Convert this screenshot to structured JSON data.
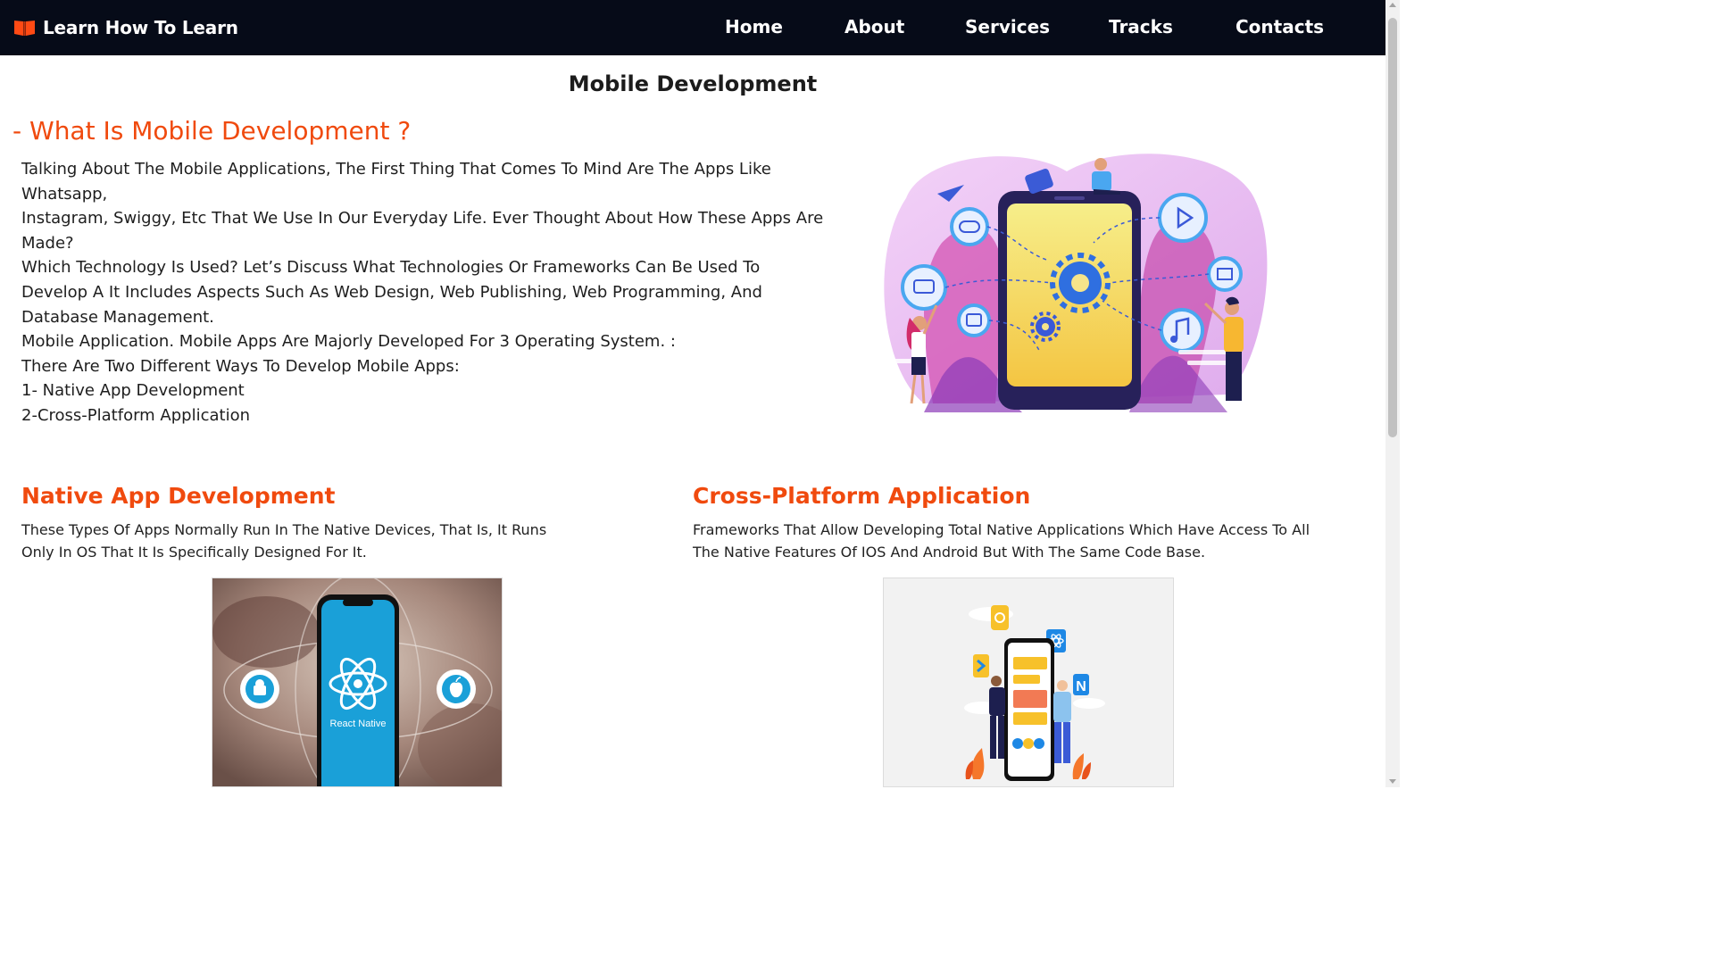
{
  "brand": {
    "name": "Learn How To Learn",
    "icon": "open-book-icon",
    "icon_color": "#ff4a14"
  },
  "nav": {
    "items": [
      {
        "label": "Home"
      },
      {
        "label": "About"
      },
      {
        "label": "Services"
      },
      {
        "label": "Tracks"
      },
      {
        "label": "Contacts"
      }
    ]
  },
  "page": {
    "title": "Mobile Development"
  },
  "intro": {
    "heading": "- What Is Mobile Development ?",
    "lines": [
      "Talking About The Mobile Applications, The First Thing That Comes To Mind Are The Apps Like",
      "Whatsapp,",
      "Instagram, Swiggy, Etc That We Use In Our Everyday Life. Ever Thought About How These Apps Are",
      "Made?",
      "Which Technology Is Used? Let’s Discuss What Technologies Or Frameworks Can Be Used To",
      "Develop A It Includes Aspects Such As Web Design, Web Publishing, Web Programming, And",
      "Database Management.",
      "Mobile Application. Mobile Apps Are Majorly Developed For 3 Operating System. :",
      "There Are Two Different Ways To Develop Mobile Apps:",
      "1- Native App Development",
      "2-Cross-Platform Application"
    ]
  },
  "native": {
    "heading": "Native App Development",
    "lines": [
      "These Types Of Apps Normally Run In The Native Devices, That Is, It Runs",
      "Only In OS That It Is Specifically Designed For It."
    ],
    "image_label": "React Native"
  },
  "cross": {
    "heading": "Cross-Platform Application",
    "lines": [
      "Frameworks That Allow Developing Total Native Applications Which Have Access To All",
      "The Native Features Of IOS And Android But With The Same Code Base."
    ]
  },
  "colors": {
    "accent": "#f04a0e",
    "navbar": "#060b18",
    "react_blue": "#1aa0d8"
  }
}
